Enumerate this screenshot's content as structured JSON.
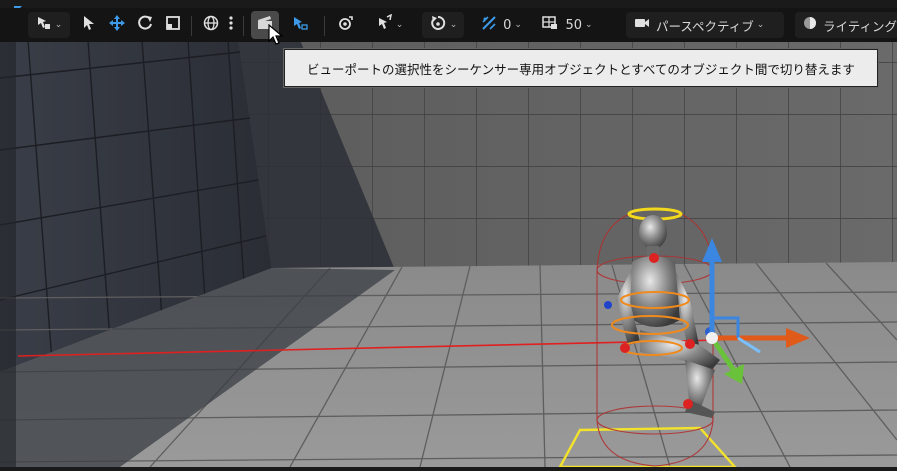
{
  "toolbar": {
    "grid_snap_value": "0",
    "camera_speed_value": "50",
    "view_mode_label": "パースペクティブ",
    "lighting_label": "ライティング"
  },
  "tooltip": {
    "text": "ビューポートの選択性をシーケンサー専用オブジェクトとすべてのオブジェクト間で切り替えます"
  },
  "icons": {
    "select_mode": "select-mode-icon",
    "select_arrow": "cursor-arrow-icon",
    "move": "move-icon",
    "rotate": "rotate-icon",
    "scale": "scale-icon",
    "world_local": "globe-icon",
    "more": "more-vertical-icon",
    "sequencer_select": "sequencer-clapper-icon",
    "select_by_hierarchy": "hierarchy-select-icon",
    "snap_surface": "snap-surface-icon",
    "grid_snap": "grid-snap-icon",
    "rotation_snap": "rotation-snap-icon",
    "camera_speed": "camera-speed-icon",
    "perspective_camera": "camera-icon",
    "lighting_sphere": "lighting-sphere-icon"
  },
  "colors": {
    "toolbar_bg": "#141414",
    "accent_blue": "#3d9be9",
    "tooltip_bg": "#ececec",
    "gizmo_x": "#e05a1a",
    "gizmo_y": "#6ac23a",
    "gizmo_z": "#3a86e0",
    "selection_yellow": "#f2d81c"
  }
}
